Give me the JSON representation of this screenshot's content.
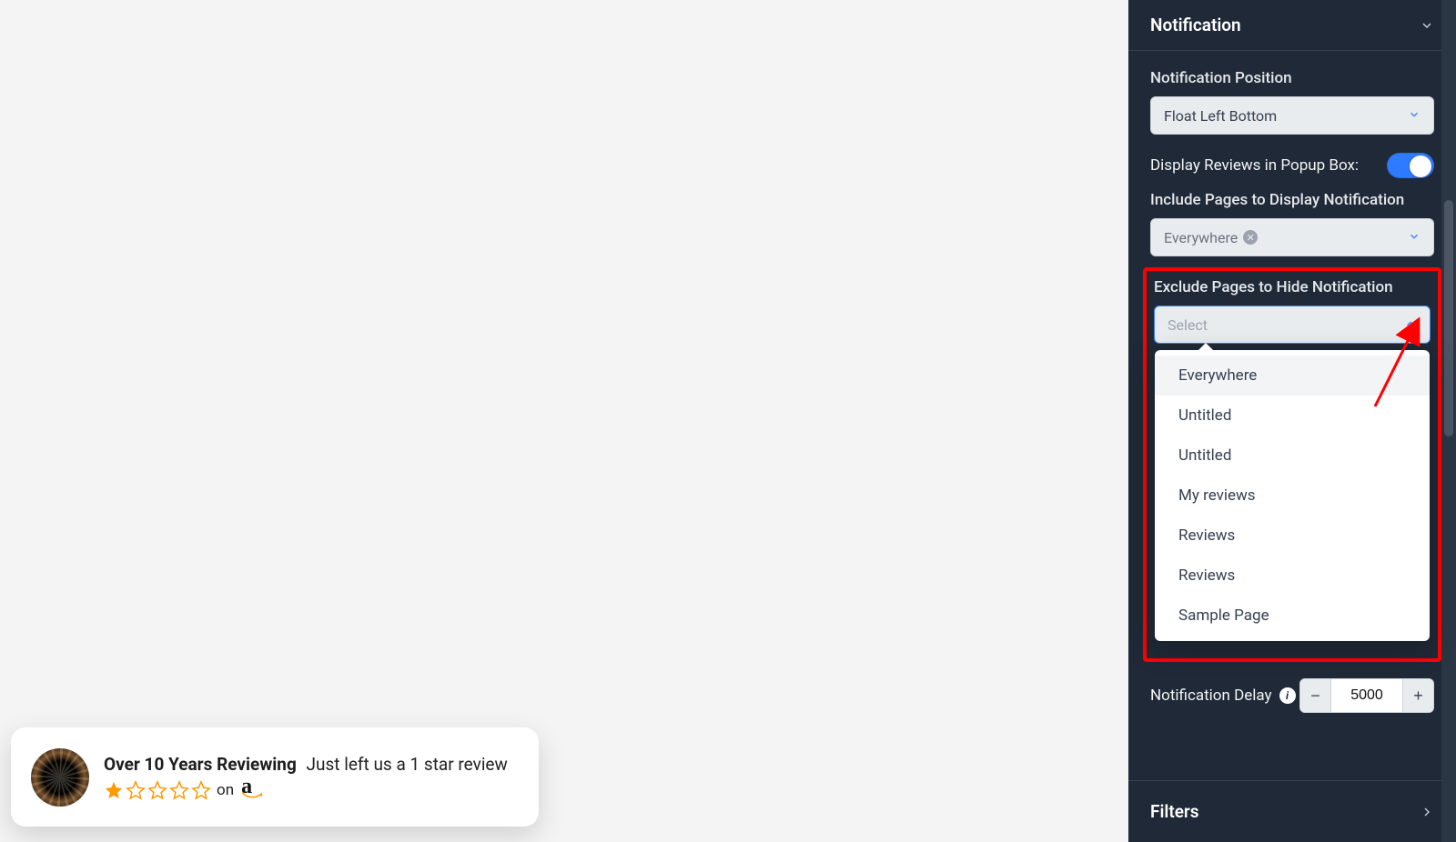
{
  "popup": {
    "title": "Over 10 Years Reviewing",
    "subtitle": "Just left us a 1 star review",
    "stars_filled": 1,
    "stars_total": 5,
    "on_text": "on",
    "platform_letter": "a",
    "star_color": "#ff9900"
  },
  "sidebar": {
    "notification": {
      "header": "Notification",
      "position_label": "Notification Position",
      "position_value": "Float Left Bottom",
      "display_popup_label": "Display Reviews in Popup Box:",
      "display_popup_on": true,
      "include_label": "Include Pages to Display Notification",
      "include_chip": "Everywhere",
      "exclude_label": "Exclude Pages to Hide Notification",
      "exclude_placeholder": "Select",
      "exclude_options": [
        "Everywhere",
        "Untitled",
        "Untitled",
        "My reviews",
        "Reviews",
        "Reviews",
        "Sample Page"
      ],
      "delay_label": "Notification Delay",
      "delay_value": "5000"
    },
    "filters": {
      "header": "Filters"
    }
  },
  "colors": {
    "accent": "#2f7bff",
    "highlight": "#ff0000"
  }
}
